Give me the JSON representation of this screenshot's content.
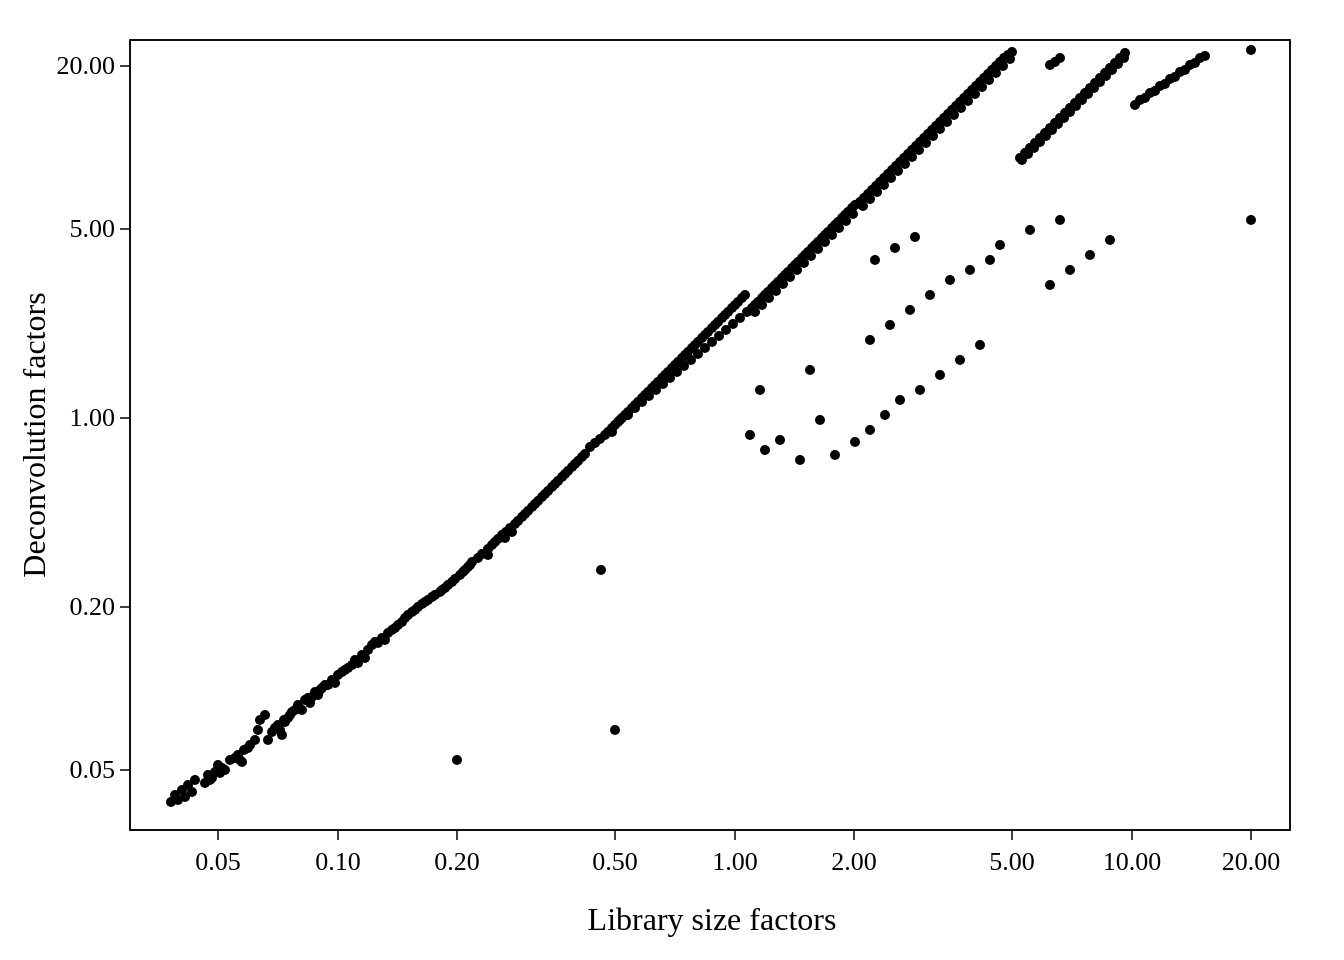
{
  "chart": {
    "title": "",
    "x_label": "Library size factors",
    "y_label": "Deconvolution factors",
    "x_ticks": [
      "0.05",
      "0.10",
      "0.20",
      "0.50",
      "1.00",
      "2.00",
      "5.00",
      "10.00",
      "20.00"
    ],
    "y_ticks": [
      "0.05",
      "0.20",
      "1.00",
      "5.00",
      "20.00"
    ],
    "background": "#ffffff",
    "dot_color": "#000000"
  }
}
